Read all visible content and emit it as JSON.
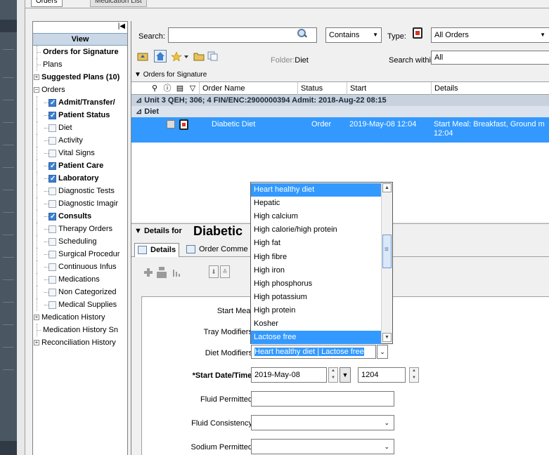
{
  "tabs": {
    "active": "Orders",
    "inactive": "Medication List"
  },
  "nav": {
    "collapse_glyph": "|◀",
    "header": "View",
    "items": [
      {
        "label": "Orders for Signature",
        "bold": true,
        "level": 1,
        "checkbox": false,
        "expander": ""
      },
      {
        "label": "Plans",
        "bold": false,
        "level": 1,
        "checkbox": false,
        "expander": ""
      },
      {
        "label": "Suggested Plans (10)",
        "bold": true,
        "level": 0,
        "checkbox": false,
        "expander": "+"
      },
      {
        "label": "Orders",
        "bold": false,
        "level": 0,
        "checkbox": false,
        "expander": "−"
      },
      {
        "label": "Admit/Transfer/",
        "bold": true,
        "level": 2,
        "checkbox": true,
        "checked": true
      },
      {
        "label": "Patient Status",
        "bold": true,
        "level": 2,
        "checkbox": true,
        "checked": true
      },
      {
        "label": "Diet",
        "bold": false,
        "level": 2,
        "checkbox": true,
        "checked": false
      },
      {
        "label": "Activity",
        "bold": false,
        "level": 2,
        "checkbox": true,
        "checked": false
      },
      {
        "label": "Vital Signs",
        "bold": false,
        "level": 2,
        "checkbox": true,
        "checked": false
      },
      {
        "label": "Patient Care",
        "bold": true,
        "level": 2,
        "checkbox": true,
        "checked": true
      },
      {
        "label": "Laboratory",
        "bold": true,
        "level": 2,
        "checkbox": true,
        "checked": true
      },
      {
        "label": "Diagnostic Tests",
        "bold": false,
        "level": 2,
        "checkbox": true,
        "checked": false
      },
      {
        "label": "Diagnostic Imagir",
        "bold": false,
        "level": 2,
        "checkbox": true,
        "checked": false
      },
      {
        "label": "Consults",
        "bold": true,
        "level": 2,
        "checkbox": true,
        "checked": true
      },
      {
        "label": "Therapy Orders",
        "bold": false,
        "level": 2,
        "checkbox": true,
        "checked": false
      },
      {
        "label": "Scheduling",
        "bold": false,
        "level": 2,
        "checkbox": true,
        "checked": false
      },
      {
        "label": "Surgical Procedur",
        "bold": false,
        "level": 2,
        "checkbox": true,
        "checked": false
      },
      {
        "label": "Continuous Infus",
        "bold": false,
        "level": 2,
        "checkbox": true,
        "checked": false
      },
      {
        "label": "Medications",
        "bold": false,
        "level": 2,
        "checkbox": true,
        "checked": false
      },
      {
        "label": "Non Categorized",
        "bold": false,
        "level": 2,
        "checkbox": true,
        "checked": false
      },
      {
        "label": "Medical Supplies",
        "bold": false,
        "level": 2,
        "checkbox": true,
        "checked": false
      },
      {
        "label": "Medication History",
        "bold": false,
        "level": 0,
        "checkbox": false,
        "expander": "+"
      },
      {
        "label": "Medication History Sn",
        "bold": false,
        "level": 1,
        "checkbox": false,
        "expander": ""
      },
      {
        "label": "Reconciliation History",
        "bold": false,
        "level": 0,
        "checkbox": false,
        "expander": "+"
      }
    ]
  },
  "search": {
    "label": "Search:",
    "value": "",
    "mode": "Contains",
    "type_label": "Type:",
    "type_value": "All Orders",
    "folder_label": "Folder:",
    "folder_value": "Diet",
    "within_label": "Search within:",
    "within_value": "All"
  },
  "orders_section": {
    "title": "Orders for Signature"
  },
  "grid": {
    "columns": [
      "Order Name",
      "Status",
      "Start",
      "Details"
    ],
    "encounter": "Unit 3 QEH; 306; 4  FIN/ENC:2900000394  Admit: 2018-Aug-22 08:15",
    "group": "Diet",
    "rows": [
      {
        "name": "Diabetic Diet",
        "status": "Order",
        "start": "2019-May-08 12:04",
        "details": "Start Meal: Breakfast, Ground m",
        "details_line2": "12:04"
      }
    ]
  },
  "details": {
    "prefix": "Details for",
    "title": "Diabetic",
    "tabs": [
      "Details",
      "Order Comme"
    ],
    "fields": {
      "start_meal_label": "Start Meal:",
      "tray_modifiers_label": "Tray Modifiers:",
      "diet_modifiers_label": "Diet Modifiers:",
      "diet_modifiers_value": "Heart healthy diet | Lactose free",
      "start_date_label": "*Start Date/Time:",
      "start_date_value": "2019-May-08",
      "start_time_value": "1204",
      "fluid_permitted_label": "Fluid Permitted:",
      "fluid_consistency_label": "Fluid Consistency:",
      "sodium_permitted_label": "Sodium Permitted:"
    }
  },
  "dropdown": {
    "options": [
      {
        "label": "Heart healthy diet",
        "selected": true
      },
      {
        "label": "Hepatic",
        "selected": false
      },
      {
        "label": "High calcium",
        "selected": false
      },
      {
        "label": "High calorie/high protein",
        "selected": false
      },
      {
        "label": "High fat",
        "selected": false
      },
      {
        "label": "High fibre",
        "selected": false
      },
      {
        "label": "High iron",
        "selected": false
      },
      {
        "label": "High phosphorus",
        "selected": false
      },
      {
        "label": "High potassium",
        "selected": false
      },
      {
        "label": "High protein",
        "selected": false
      },
      {
        "label": "Kosher",
        "selected": false
      },
      {
        "label": "Lactose free",
        "selected": true
      }
    ]
  },
  "colors": {
    "selection": "#3399ff",
    "nav_header": "#c9d7e6",
    "encounter_row": "#c8d2df",
    "gutter": "#4a5661"
  }
}
